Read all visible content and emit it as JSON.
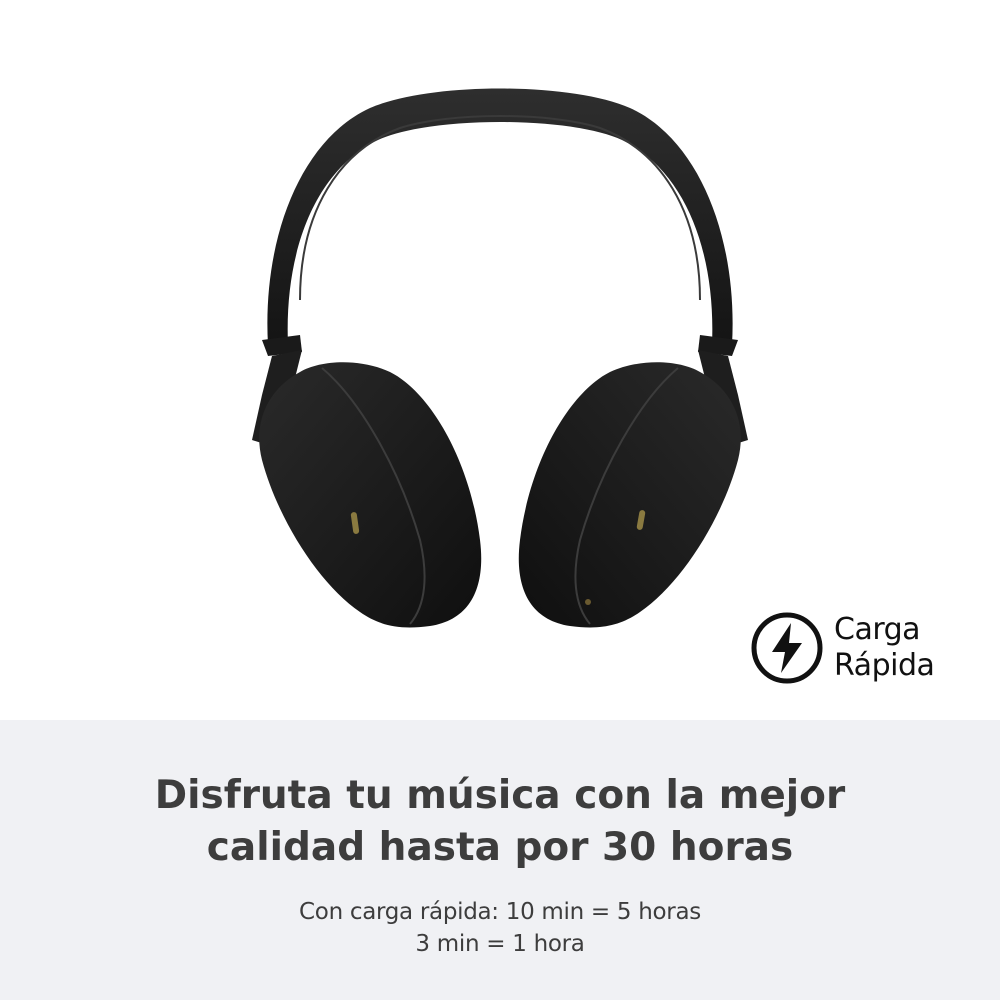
{
  "badge": {
    "icon": "lightning-bolt-icon",
    "line1": "Carga",
    "line2": "Rápida"
  },
  "headline": {
    "line1": "Disfruta tu música con la mejor",
    "line2": "calidad hasta por 30 horas"
  },
  "subtext": {
    "line1": "Con carga rápida: 10 min = 5 horas",
    "line2": "3 min = 1 hora"
  },
  "colors": {
    "panel_background": "#f0f1f4",
    "headline_text": "#3d3d3d",
    "product": "#1c1c1c"
  }
}
